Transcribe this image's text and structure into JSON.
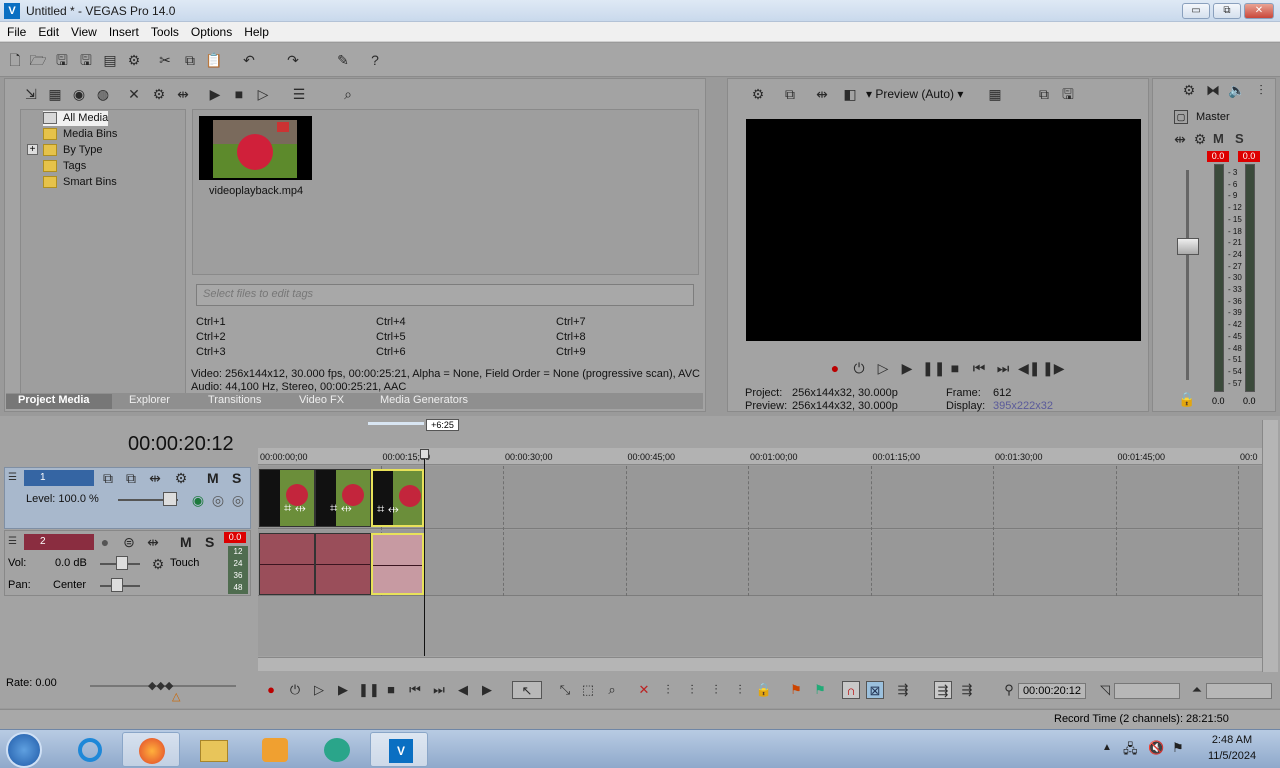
{
  "window": {
    "title": "Untitled * - VEGAS Pro 14.0",
    "logo": "V",
    "min": "▭",
    "restore": "⧉",
    "close": "✕"
  },
  "menu": [
    "File",
    "Edit",
    "View",
    "Insert",
    "Tools",
    "Options",
    "Help"
  ],
  "media": {
    "tree": [
      "All Media",
      "Media Bins",
      "By Type",
      "Tags",
      "Smart Bins"
    ],
    "expander": "+",
    "file_name": "videoplayback.mp4",
    "tag_placeholder": "Select files to edit tags",
    "shortcuts": [
      "Ctrl+1",
      "Ctrl+4",
      "Ctrl+7",
      "Ctrl+2",
      "Ctrl+5",
      "Ctrl+8",
      "Ctrl+3",
      "Ctrl+6",
      "Ctrl+9"
    ],
    "info_video": "Video: 256x144x12, 30.000 fps, 00:00:25:21, Alpha = None, Field Order = None (progressive scan), AVC",
    "info_audio": "Audio: 44,100 Hz, Stereo, 00:00:25:21, AAC",
    "tabs": [
      "Project Media",
      "Explorer",
      "Transitions",
      "Video FX",
      "Media Generators"
    ]
  },
  "preview": {
    "mode": "Preview (Auto)",
    "project_label": "Project:",
    "project_value": "256x144x32, 30.000p",
    "preview_label": "Preview:",
    "preview_value": "256x144x32, 30.000p",
    "frame_label": "Frame:",
    "frame_value": "612",
    "display_label": "Display:",
    "display_value": "395x222x32"
  },
  "master": {
    "title": "Master",
    "peak_l": "0.0",
    "peak_r": "0.0",
    "scale": [
      "3",
      "6",
      "9",
      "12",
      "15",
      "18",
      "21",
      "24",
      "27",
      "30",
      "33",
      "36",
      "39",
      "42",
      "45",
      "48",
      "51",
      "54",
      "57"
    ],
    "bottom_l": "0.0",
    "bottom_r": "0.0",
    "m": "M",
    "s": "S"
  },
  "timeline": {
    "timecode": "00:00:20:12",
    "loop_badge": "+6:25",
    "ruler": [
      "00:00:00;00",
      "00:00:15;00",
      "00:00:30;00",
      "00:00:45;00",
      "00:01:00;00",
      "00:01:15;00",
      "00:01:30;00",
      "00:01:45;00",
      "00:0"
    ],
    "track1": {
      "num": "1",
      "level": "Level: 100.0 %",
      "m": "M",
      "s": "S"
    },
    "track2": {
      "num": "2",
      "vol_label": "Vol:",
      "vol_value": "0.0 dB",
      "pan_label": "Pan:",
      "pan_value": "Center",
      "mode": "Touch",
      "peak": "0.0",
      "scale": [
        "12",
        "24",
        "36",
        "48"
      ],
      "m": "M",
      "s": "S"
    },
    "rate": "Rate: 0.00",
    "cursor_time": "00:00:20:12",
    "record_time": "Record Time (2 channels): 28:21:50"
  },
  "taskbar": {
    "time": "2:48 AM",
    "date": "11/5/2024"
  }
}
